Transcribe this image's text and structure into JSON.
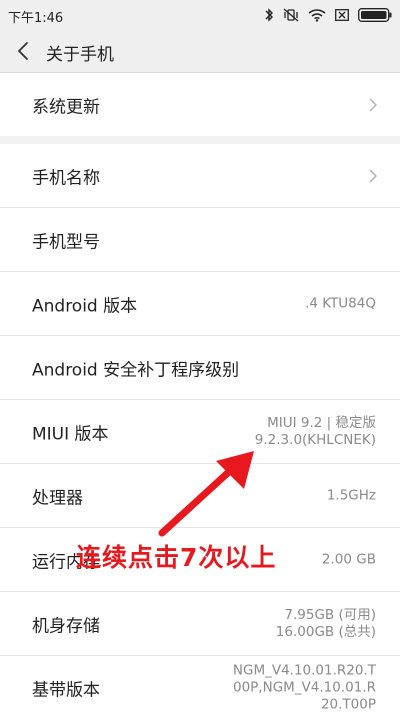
{
  "status_bar": {
    "time": "下午1:46",
    "icons": [
      "bluetooth-icon",
      "vibrate-off-icon",
      "wifi-icon",
      "sim-x-icon",
      "battery-icon"
    ]
  },
  "nav": {
    "title": "关于手机"
  },
  "groups": [
    {
      "rows": [
        {
          "label": "系统更新",
          "values": [],
          "chevron": true
        }
      ]
    },
    {
      "rows": [
        {
          "label": "手机名称",
          "values": [],
          "chevron": true
        },
        {
          "label": "手机型号",
          "values": [],
          "chevron": false
        },
        {
          "label": "Android 版本",
          "values": [
            ".4 KTU84Q"
          ],
          "chevron": false
        },
        {
          "label": "Android 安全补丁程序级别",
          "values": [],
          "chevron": false
        },
        {
          "label": "MIUI 版本",
          "values": [
            "MIUI 9.2 | 稳定版",
            "9.2.3.0(KHLCNEK)"
          ],
          "chevron": false
        },
        {
          "label": "处理器",
          "values": [
            "1.5GHz"
          ],
          "chevron": false
        },
        {
          "label": "运行内存",
          "values": [
            "2.00 GB"
          ],
          "chevron": false
        },
        {
          "label": "机身存储",
          "values": [
            "7.95GB (可用)",
            "16.00GB (总共)"
          ],
          "chevron": false
        },
        {
          "label": "基带版本",
          "values": [
            "NGM_V4.10.01.R20.T",
            "00P,NGM_V4.10.01.R",
            "20.T00P"
          ],
          "chevron": false
        }
      ]
    }
  ],
  "annotation": {
    "text": "连续点击7次以上",
    "color": "#e8191e"
  }
}
